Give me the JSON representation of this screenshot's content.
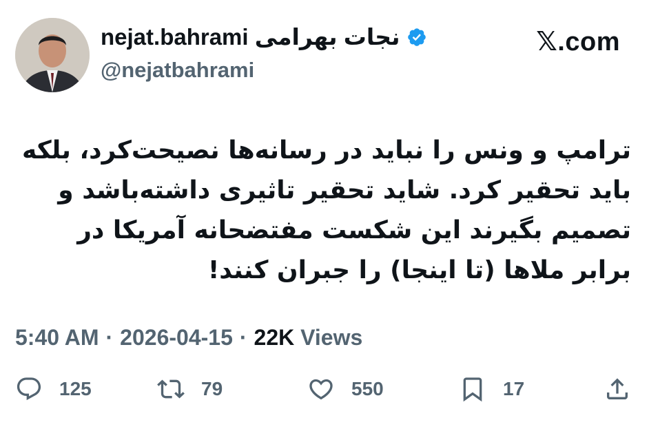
{
  "author": {
    "display_name": "nejat.bahrami نجات بهرامی",
    "handle": "@nejatbahrami",
    "verified": true
  },
  "site_label": "𝕏.com",
  "tweet": {
    "text": "ترامپ و ونس را نباید در رسانه‌ها نصیحت‌کرد، بلکه باید تحقیر کرد. شاید تحقیر تاثیری داشته‌باشد و تصمیم بگیرند این شکست مفتضحانه آمریکا در برابر ملاها (تا اینجا) را جبران کنند!"
  },
  "meta": {
    "time": "5:40 AM",
    "separator": "·",
    "date": "2026-04-15",
    "views_count": "22K",
    "views_label": "Views"
  },
  "actions": {
    "replies": "125",
    "reposts": "79",
    "likes": "550",
    "bookmarks": "17"
  },
  "icons": {
    "verified": "verified-badge-icon",
    "reply": "reply-icon",
    "repost": "repost-icon",
    "like": "heart-icon",
    "bookmark": "bookmark-icon",
    "share": "share-icon"
  },
  "colors": {
    "text": "#0f1419",
    "secondary": "#536471",
    "verified": "#1d9bf0"
  }
}
